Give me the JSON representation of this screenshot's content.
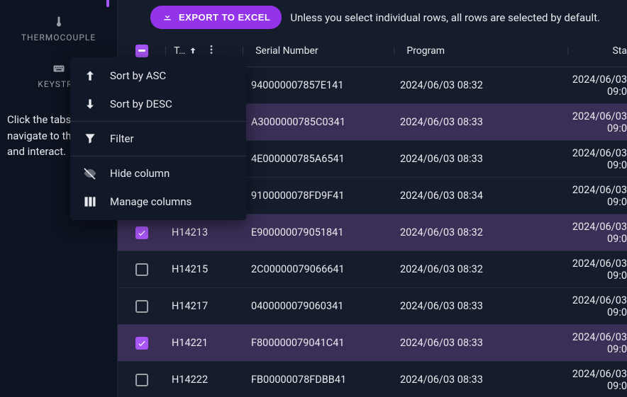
{
  "sidebar": {
    "items": [
      {
        "label": "THERMOCOUPLE",
        "icon": "thermometer-icon"
      },
      {
        "label": "KEYSTRO",
        "icon": "keyboard-icon"
      }
    ],
    "help_text": "Click the tabs to navigate to the tables and interact."
  },
  "toolbar": {
    "export_label": "EXPORT TO EXCEL",
    "hint": "Unless you select individual rows, all rows are selected by default."
  },
  "columns": {
    "tag": "T…",
    "serial": "Serial Number",
    "program": "Program",
    "start": "Sta"
  },
  "menu": {
    "sort_asc": "Sort by ASC",
    "sort_desc": "Sort by DESC",
    "filter": "Filter",
    "hide": "Hide column",
    "manage": "Manage columns"
  },
  "rows": [
    {
      "checked": false,
      "tag": "",
      "serial": "940000007857E141",
      "program": "2024/06/03 08:32",
      "start": "2024/06/03 09:0"
    },
    {
      "checked": false,
      "tag": "",
      "serial": "A3000000785C0341",
      "program": "2024/06/03 08:33",
      "start": "2024/06/03 09:0",
      "sel": true
    },
    {
      "checked": false,
      "tag": "",
      "serial": "4E000000785A6541",
      "program": "2024/06/03 08:33",
      "start": "2024/06/03 09:0"
    },
    {
      "checked": false,
      "tag": "",
      "serial": "9100000078FD9F41",
      "program": "2024/06/03 08:34",
      "start": "2024/06/03 09:0"
    },
    {
      "checked": true,
      "tag": "H14213",
      "serial": "E900000079051841",
      "program": "2024/06/03 08:32",
      "start": "2024/06/03 09:0",
      "sel": true
    },
    {
      "checked": false,
      "tag": "H14215",
      "serial": "2C00000079066641",
      "program": "2024/06/03 08:32",
      "start": "2024/06/03 09:0"
    },
    {
      "checked": false,
      "tag": "H14217",
      "serial": "0400000079060341",
      "program": "2024/06/03 08:33",
      "start": "2024/06/03 09:0"
    },
    {
      "checked": true,
      "tag": "H14221",
      "serial": "F800000079041C41",
      "program": "2024/06/03 08:33",
      "start": "2024/06/03 09:0",
      "sel": true
    },
    {
      "checked": false,
      "tag": "H14222",
      "serial": "FB00000078FDBB41",
      "program": "2024/06/03 08:33",
      "start": "2024/06/03 09:0"
    }
  ],
  "colors": {
    "accent": "#a855f7"
  }
}
